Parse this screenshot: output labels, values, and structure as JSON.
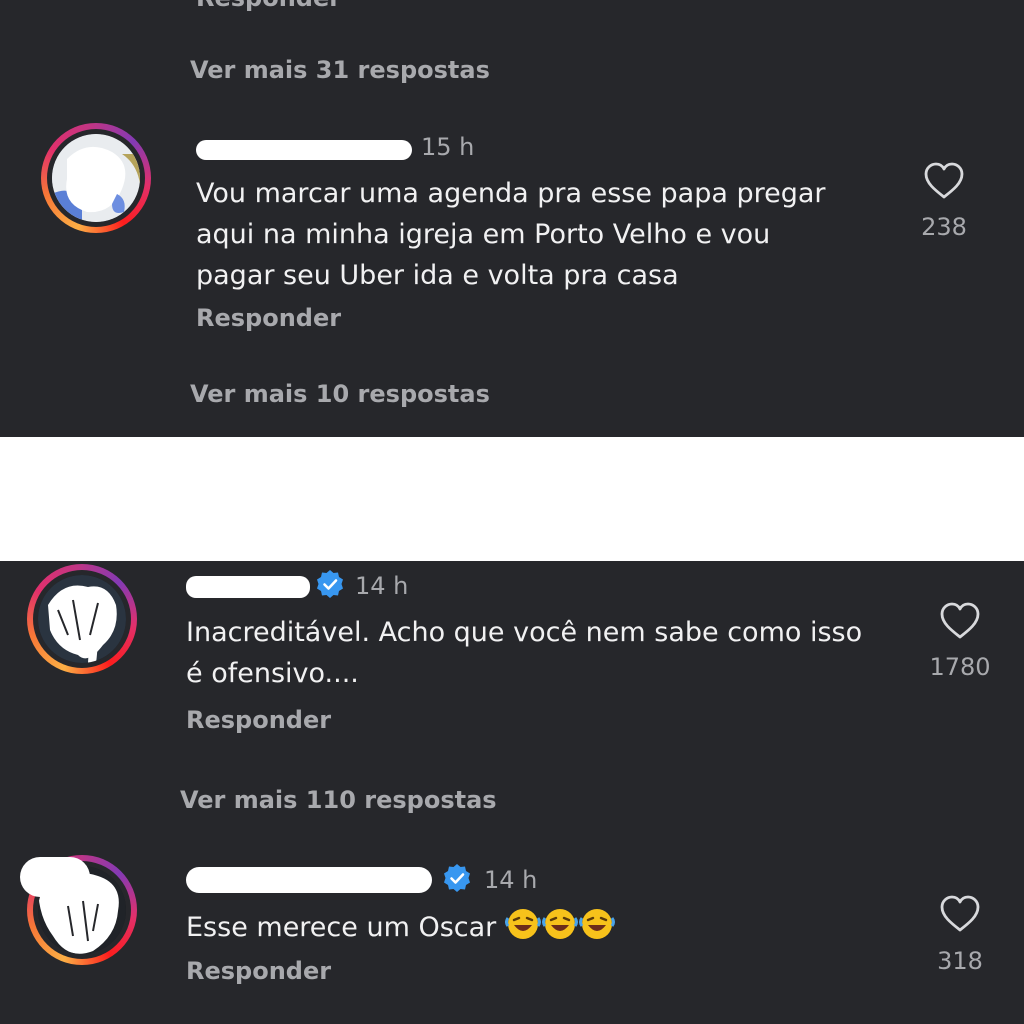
{
  "top_panel": {
    "cut_reply_label": "Responder",
    "thread1_more": "Ver mais 31 respostas",
    "comment": {
      "time": "15 h",
      "text": "Vou marcar uma agenda pra esse papa pregar aqui na minha igreja em Porto Velho e vou pagar seu Uber ida e volta pra casa",
      "reply_label": "Responder",
      "likes": "238"
    },
    "more_replies": "Ver mais 10 respostas"
  },
  "bottom_panel": {
    "comments": [
      {
        "time": "14 h",
        "verified": true,
        "text": "Inacreditável. Acho que você nem sabe como isso é ofensivo....",
        "reply_label": "Responder",
        "likes": "1780",
        "more_replies": "Ver mais 110 respostas"
      },
      {
        "time": "14 h",
        "verified": true,
        "text": "Esse merece um Oscar",
        "emoji": "🤣🤣🤣",
        "reply_label": "Responder",
        "likes": "318"
      }
    ]
  },
  "colors": {
    "background": "#26272b",
    "primary_text": "#f1f1f2",
    "secondary_text": "#a8a9ad",
    "verified_blue": "#3897f0",
    "separator": "#ffffff"
  },
  "icons": [
    "heart-icon",
    "verified-badge-icon",
    "laughing-emoji"
  ]
}
